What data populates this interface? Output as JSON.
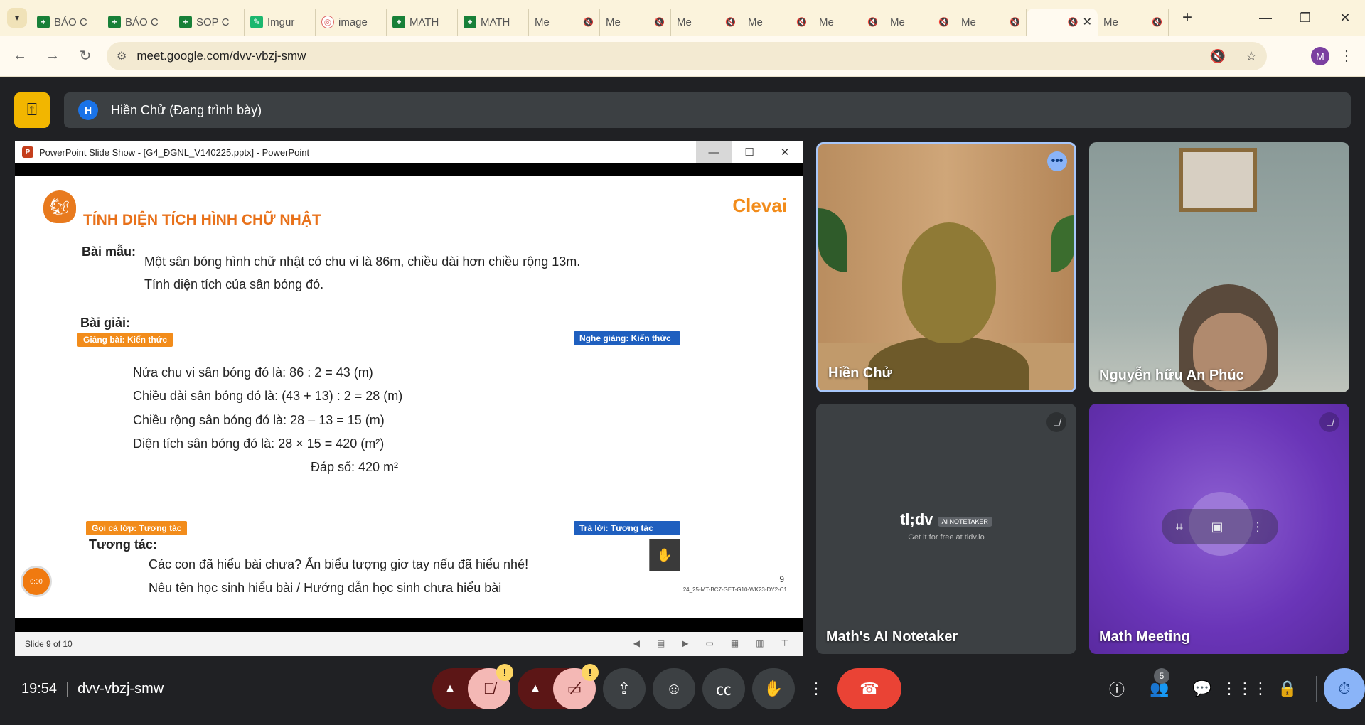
{
  "browser": {
    "tabs": [
      {
        "title": "BÁO C",
        "icon": "sheets-icon",
        "fav": "+",
        "type": "sheet"
      },
      {
        "title": "BÁO C",
        "icon": "sheets-icon",
        "fav": "+",
        "type": "sheet"
      },
      {
        "title": "SOP C",
        "icon": "sheets-icon",
        "fav": "+",
        "type": "sheet"
      },
      {
        "title": "Imgur",
        "icon": "imgur-icon",
        "fav": "✎",
        "type": "imgur"
      },
      {
        "title": "image",
        "icon": "image-icon",
        "fav": "◎",
        "type": "image"
      },
      {
        "title": "MATH",
        "icon": "sheets-icon",
        "fav": "+",
        "type": "sheet"
      },
      {
        "title": "MATH",
        "icon": "sheets-icon",
        "fav": "+",
        "type": "sheet"
      },
      {
        "title": "Me",
        "icon": "meet-icon",
        "fav": "",
        "type": "meet",
        "muted": true
      },
      {
        "title": "Me",
        "icon": "meet-icon",
        "fav": "",
        "type": "meet",
        "muted": true
      },
      {
        "title": "Me",
        "icon": "meet-icon",
        "fav": "",
        "type": "meet",
        "muted": true
      },
      {
        "title": "Me",
        "icon": "meet-icon",
        "fav": "",
        "type": "meet",
        "muted": true
      },
      {
        "title": "Me",
        "icon": "meet-icon",
        "fav": "",
        "type": "meet",
        "muted": true
      },
      {
        "title": "Me",
        "icon": "meet-icon",
        "fav": "",
        "type": "meet",
        "muted": true
      },
      {
        "title": "Me",
        "icon": "meet-icon",
        "fav": "",
        "type": "meet",
        "muted": true
      },
      {
        "title": "",
        "icon": "meet-icon",
        "fav": "",
        "type": "meet",
        "muted": true,
        "active": true
      },
      {
        "title": "Me",
        "icon": "meet-icon",
        "fav": "",
        "type": "meet",
        "muted": true
      }
    ],
    "url": "meet.google.com/dvv-vbzj-smw",
    "profile_initial": "M"
  },
  "meet": {
    "presenter_initial": "H",
    "presenter_label": "Hiền Chử (Đang trình bày)",
    "ppt": {
      "window_title": "PowerPoint Slide Show - [G4_ĐGNL_V140225.pptx] - PowerPoint",
      "status": "Slide 9 of 10",
      "slide": {
        "title": "TÍNH DIỆN TÍCH HÌNH CHỮ NHẬT",
        "brand": "Clevai",
        "example_label": "Bài mẫu:",
        "example_line1": "Một sân bóng hình chữ nhật có chu vi là 86m, chiều dài hơn chiều rộng 13m.",
        "example_line2": "Tính diện tích của sân bóng đó.",
        "solution_label": "Bài giải:",
        "tag_teach": "Giảng bài: Kiến thức",
        "tag_listen": "Nghe giảng: Kiến thức",
        "step1": "Nửa chu vi sân bóng đó là:   86 : 2 = 43 (m)",
        "step2": "Chiều dài sân bóng đó là:   (43 + 13) : 2 = 28 (m)",
        "step3": "Chiều rộng sân bóng đó là:   28 – 13 = 15 (m)",
        "step4": "Diện tích sân bóng đó là:   28 × 15 = 420 (m²)",
        "answer": "Đáp số: 420 m²",
        "tag_call": "Gọi cả lớp: Tương tác",
        "tag_answer": "Trả lời: Tương tác",
        "interact_label": "Tương tác:",
        "interact_line1": "Các con đã hiểu bài chưa? Ấn biểu tượng giơ tay nếu đã hiểu nhé!",
        "interact_line2": "Nêu tên học sinh hiểu bài / Hướng dẫn học sinh chưa hiểu bài",
        "timer": "0:00",
        "page": "9",
        "code": "24_25-MT-BC7-GET-G10-WK23-DY2-C1"
      }
    },
    "participants": [
      {
        "name": "Hiền Chử"
      },
      {
        "name": "Nguyễn hữu An Phúc"
      },
      {
        "name": "Math's AI Notetaker",
        "logo": "tl;dv",
        "chip": "AI NOTETAKER",
        "sub": "Get it for free at tldv.io"
      },
      {
        "name": "Math Meeting"
      }
    ],
    "bottom": {
      "time": "19:54",
      "meeting_code": "dvv-vbzj-smw",
      "people_count": "5"
    }
  }
}
